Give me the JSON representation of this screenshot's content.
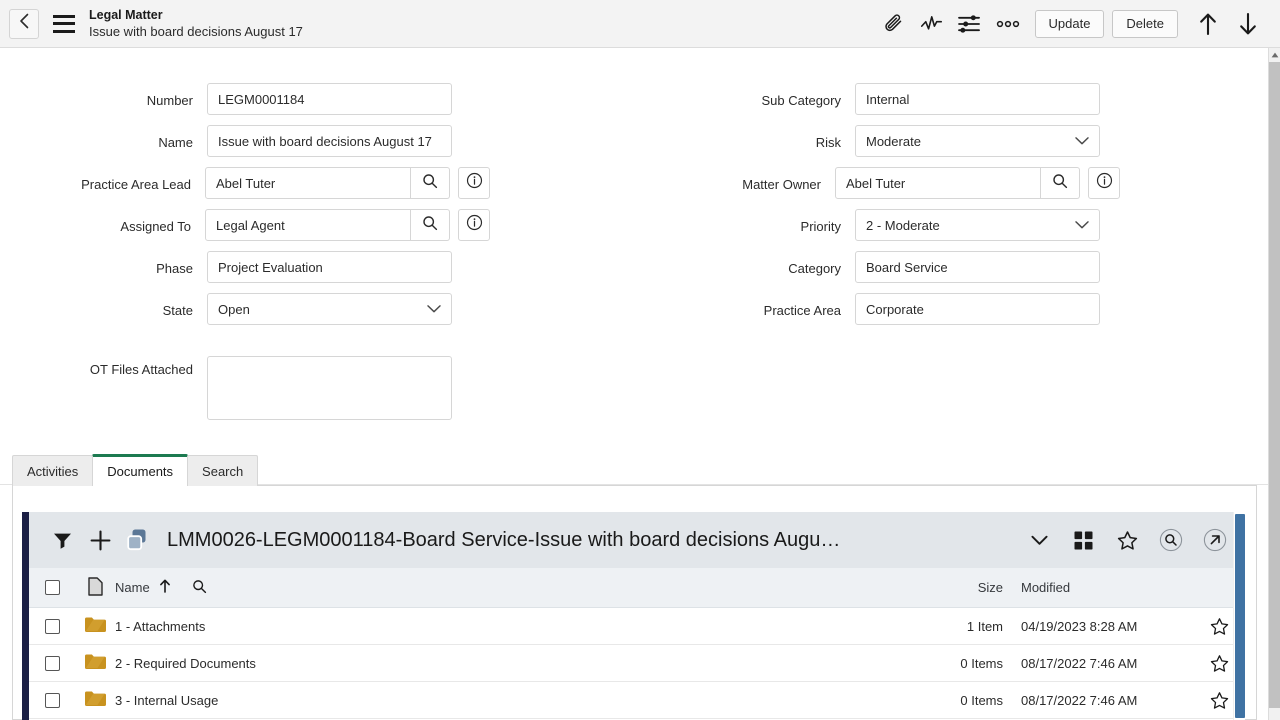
{
  "header": {
    "title": "Legal Matter",
    "subtitle": "Issue with board decisions August 17",
    "back_icon": "chevron-left-icon",
    "menu_icon": "hamburger-menu-icon",
    "icons": [
      {
        "name": "attachment-paperclip-icon",
        "glyph": "paperclip"
      },
      {
        "name": "activity-stream-icon",
        "glyph": "pulse"
      },
      {
        "name": "personalize-form-icon",
        "glyph": "sliders"
      },
      {
        "name": "more-options-icon",
        "glyph": "ellipsis"
      }
    ],
    "update_label": "Update",
    "delete_label": "Delete",
    "up_icon": "arrow-up-icon",
    "down_icon": "arrow-down-icon"
  },
  "form": {
    "left": [
      {
        "label": "Number",
        "value": "LEGM0001184",
        "type": "text"
      },
      {
        "label": "Name",
        "value": "Issue with board decisions August 17",
        "type": "text"
      },
      {
        "label": "Practice Area Lead",
        "value": "Abel Tuter",
        "type": "reference"
      },
      {
        "label": "Assigned To",
        "value": "Legal Agent",
        "type": "reference"
      },
      {
        "label": "Phase",
        "value": "Project Evaluation",
        "type": "text"
      },
      {
        "label": "State",
        "value": "Open",
        "type": "select"
      },
      {
        "label": "OT Files Attached",
        "value": "",
        "type": "textarea"
      }
    ],
    "right": [
      {
        "label": "Sub Category",
        "value": "Internal",
        "type": "text"
      },
      {
        "label": "Risk",
        "value": "Moderate",
        "type": "select"
      },
      {
        "label": "Matter Owner",
        "value": "Abel Tuter",
        "type": "reference"
      },
      {
        "label": "Priority",
        "value": "2 - Moderate",
        "type": "select"
      },
      {
        "label": "Category",
        "value": "Board Service",
        "type": "text"
      },
      {
        "label": "Practice Area",
        "value": "Corporate",
        "type": "text"
      }
    ]
  },
  "tabs": [
    {
      "label": "Activities",
      "active": false
    },
    {
      "label": "Documents",
      "active": true
    },
    {
      "label": "Search",
      "active": false
    }
  ],
  "documents": {
    "title": "LMM0026-LEGM0001184-Board Service-Issue with board decisions Augu…",
    "left_icons": [
      {
        "name": "filter-icon",
        "glyph": "funnel"
      },
      {
        "name": "add-new-icon",
        "glyph": "plus"
      },
      {
        "name": "copy-layers-icon",
        "glyph": "layers"
      }
    ],
    "right_icons": [
      {
        "name": "chevron-down-icon",
        "glyph": "chevron"
      },
      {
        "name": "grid-view-icon",
        "glyph": "grid"
      },
      {
        "name": "favorite-star-icon",
        "glyph": "star"
      },
      {
        "name": "search-icon",
        "glyph": "search-circle"
      },
      {
        "name": "open-external-icon",
        "glyph": "external-circle"
      }
    ],
    "columns": {
      "select_all": "",
      "type_icon": "document-icon",
      "name": "Name",
      "sort": "ascending",
      "search_icon": "search-icon",
      "size": "Size",
      "modified": "Modified"
    },
    "rows": [
      {
        "name": "1 - Attachments",
        "size": "1 Item",
        "modified": "04/19/2023 8:28 AM",
        "icon": "folder-icon"
      },
      {
        "name": "2 - Required Documents",
        "size": "0 Items",
        "modified": "08/17/2022 7:46 AM",
        "icon": "folder-icon"
      },
      {
        "name": "3 - Internal Usage",
        "size": "0 Items",
        "modified": "08/17/2022 7:46 AM",
        "icon": "folder-icon"
      }
    ]
  },
  "colors": {
    "header_bg": "#f3f3f3",
    "active_tab_accent": "#1c7a50",
    "docs_rail": "#1b1f45",
    "docs_head_bg": "#e2e6ea",
    "folder": "#c8921f",
    "scrollbar": "#3f72a3"
  }
}
